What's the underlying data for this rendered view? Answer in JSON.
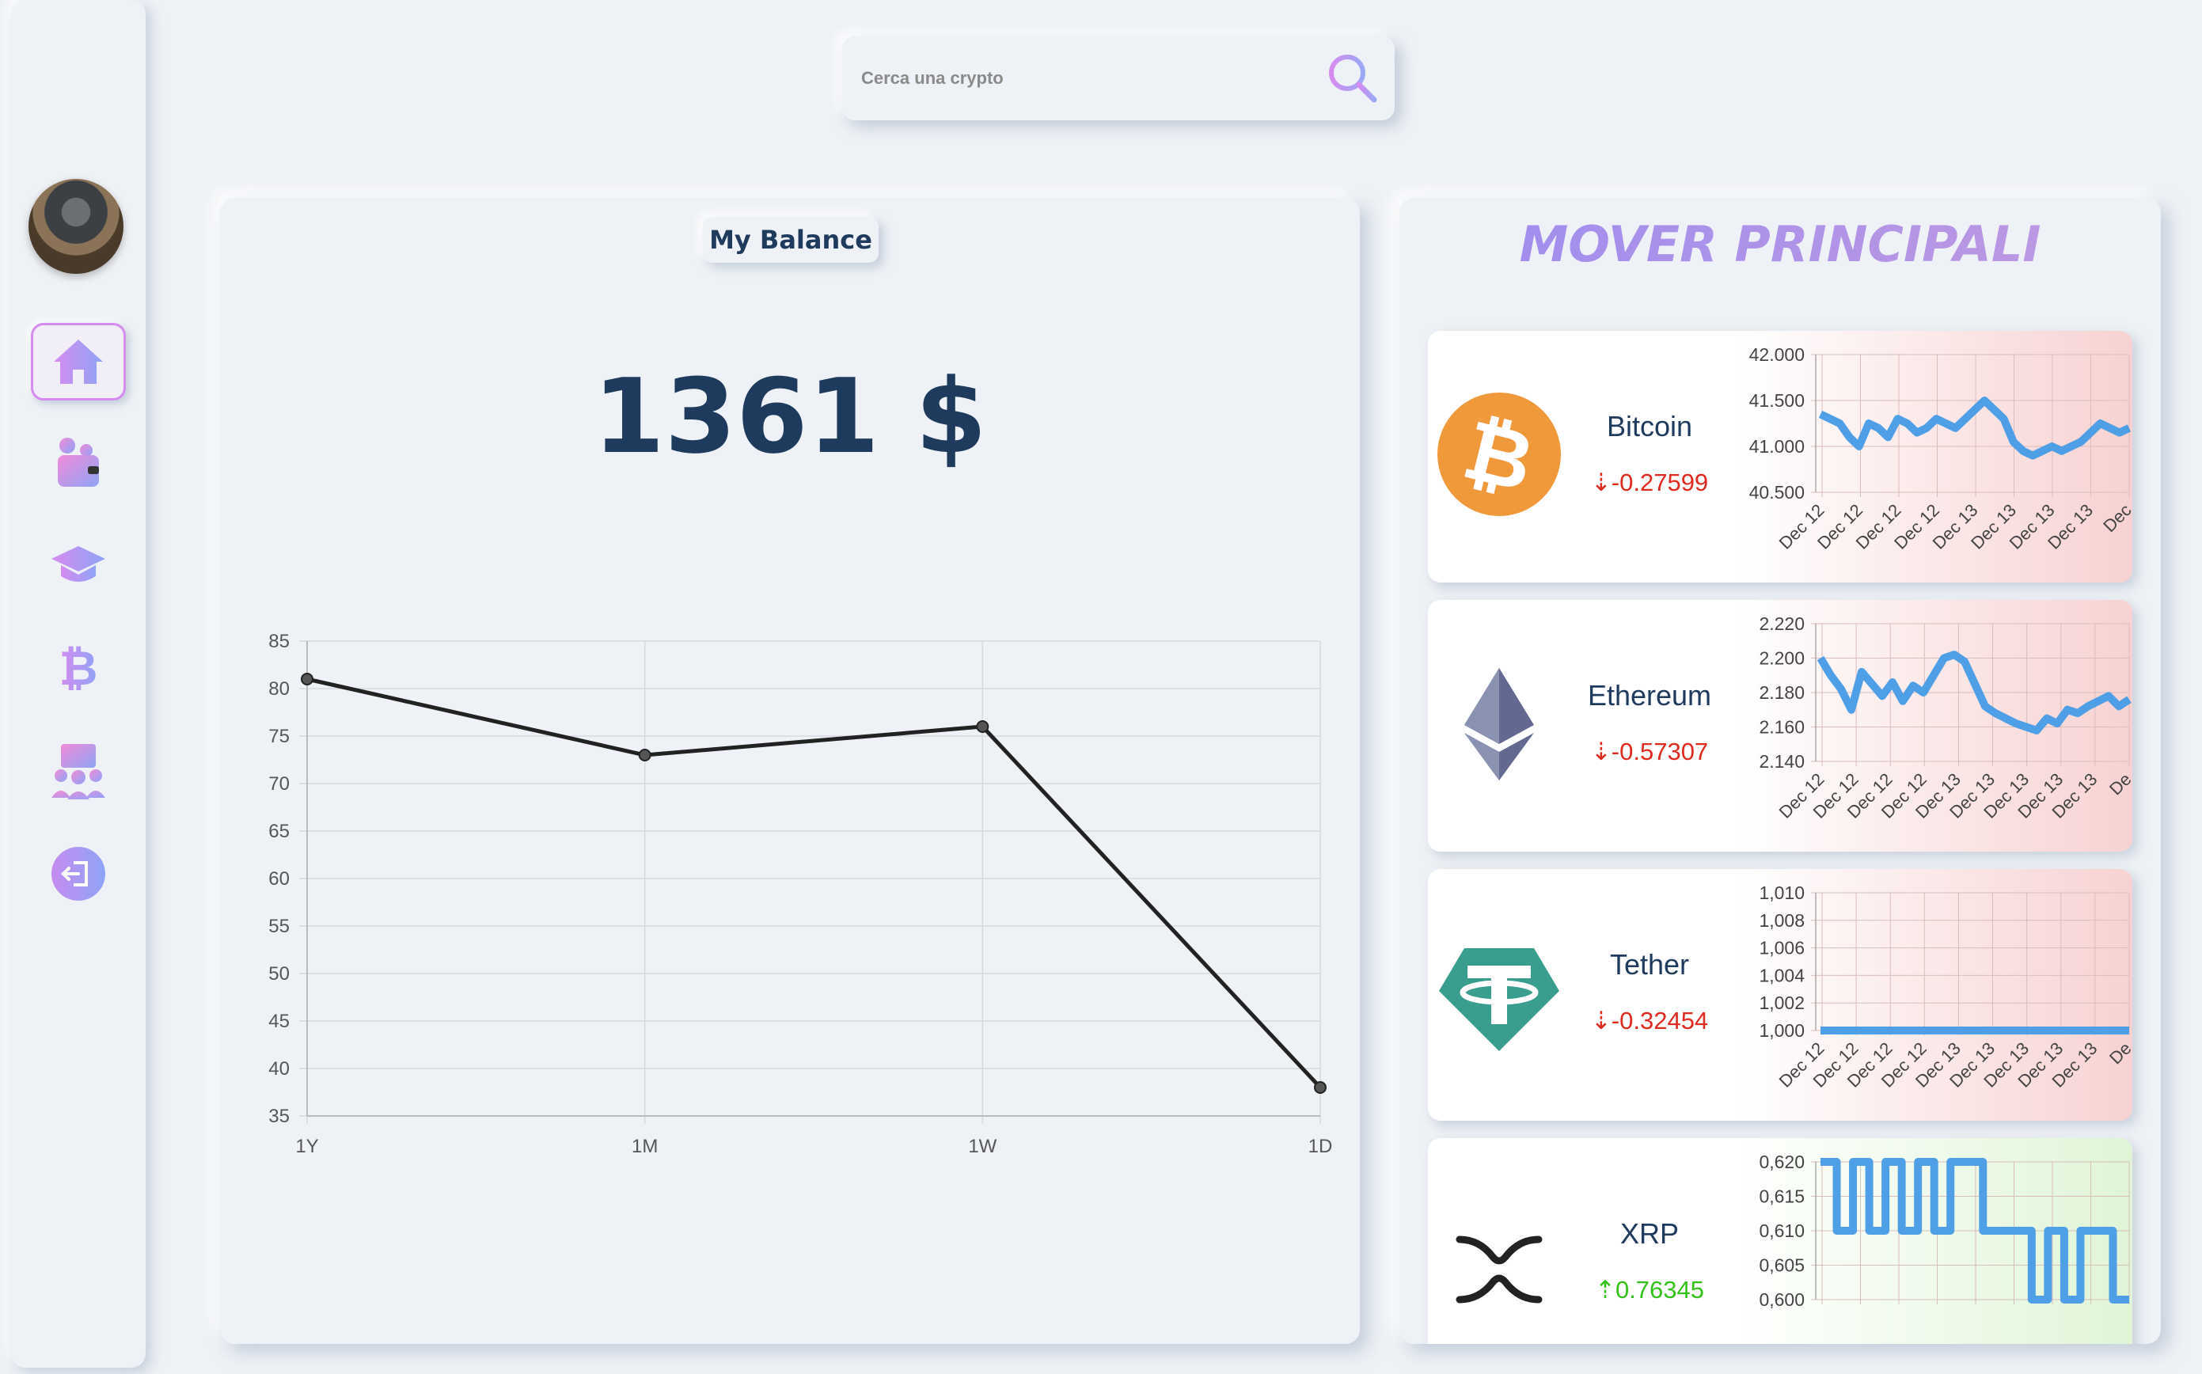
{
  "search": {
    "placeholder": "Cerca una crypto"
  },
  "sidebar": {
    "items": [
      {
        "name": "home",
        "active": true
      },
      {
        "name": "wallet"
      },
      {
        "name": "education"
      },
      {
        "name": "bitcoin"
      },
      {
        "name": "community"
      },
      {
        "name": "logout"
      }
    ]
  },
  "balance": {
    "title": "My Balance",
    "value": "1361 $",
    "chart_data": {
      "type": "line",
      "categories": [
        "1Y",
        "1M",
        "1W",
        "1D"
      ],
      "values": [
        81,
        73,
        76,
        38
      ],
      "ylim": [
        35,
        85
      ],
      "yticks": [
        35,
        40,
        45,
        50,
        55,
        60,
        65,
        70,
        75,
        80,
        85
      ],
      "grid": true,
      "line_color": "#222222"
    }
  },
  "movers": {
    "title": "MOVER PRINCIPALI",
    "coins": [
      {
        "name": "Bitcoin",
        "change": "-0.27599",
        "direction": "down",
        "icon": "bitcoin-icon",
        "chart_data": {
          "type": "line",
          "yticks": [
            "42.000",
            "41.500",
            "41.000",
            "40.500"
          ],
          "ylim": [
            40500,
            42000
          ],
          "xticks": [
            "Dec 12",
            "Dec 12",
            "Dec 12",
            "Dec 12",
            "Dec 13",
            "Dec 13",
            "Dec 13",
            "Dec 13",
            "Dec"
          ],
          "values": [
            41350,
            41300,
            41250,
            41100,
            41000,
            41250,
            41200,
            41100,
            41300,
            41250,
            41150,
            41200,
            41300,
            41250,
            41200,
            41300,
            41400,
            41500,
            41400,
            41300,
            41050,
            40950,
            40900,
            40950,
            41000,
            40950,
            41000,
            41050,
            41150,
            41250,
            41200,
            41150,
            41200
          ],
          "background": "red"
        }
      },
      {
        "name": "Ethereum",
        "change": "-0.57307",
        "direction": "down",
        "icon": "ethereum-icon",
        "chart_data": {
          "type": "line",
          "yticks": [
            "2.220",
            "2.200",
            "2.180",
            "2.160",
            "2.140"
          ],
          "ylim": [
            2140,
            2220
          ],
          "xticks": [
            "Dec 12",
            "Dec 12",
            "Dec 12",
            "Dec 12",
            "Dec 13",
            "Dec 13",
            "Dec 13",
            "Dec 13",
            "Dec 13",
            "De"
          ],
          "values": [
            2200,
            2190,
            2182,
            2170,
            2192,
            2185,
            2178,
            2186,
            2175,
            2184,
            2180,
            2190,
            2200,
            2202,
            2198,
            2185,
            2172,
            2168,
            2165,
            2162,
            2160,
            2158,
            2165,
            2162,
            2170,
            2168,
            2172,
            2175,
            2178,
            2172,
            2176
          ],
          "background": "red"
        }
      },
      {
        "name": "Tether",
        "change": "-0.32454",
        "direction": "down",
        "icon": "tether-icon",
        "chart_data": {
          "type": "line",
          "yticks": [
            "1,010",
            "1,008",
            "1,006",
            "1,004",
            "1,002",
            "1,000"
          ],
          "ylim": [
            1.0,
            1.01
          ],
          "xticks": [
            "Dec 12",
            "Dec 12",
            "Dec 12",
            "Dec 12",
            "Dec 13",
            "Dec 13",
            "Dec 13",
            "Dec 13",
            "Dec 13",
            "De"
          ],
          "values": [
            1.0,
            1.0,
            1.0,
            1.0,
            1.0,
            1.0,
            1.0,
            1.0,
            1.0,
            1.0,
            1.0,
            1.0
          ],
          "background": "red"
        }
      },
      {
        "name": "XRP",
        "change": "0.76345",
        "direction": "up",
        "icon": "xrp-icon",
        "chart_data": {
          "type": "line",
          "yticks": [
            "0,620",
            "0,615",
            "0,610",
            "0,605",
            "0,600"
          ],
          "ylim": [
            0.6,
            0.62
          ],
          "values": [
            0.62,
            0.61,
            0.62,
            0.61,
            0.62,
            0.61,
            0.62,
            0.61,
            0.62,
            0.62,
            0.61,
            0.61,
            0.61,
            0.6,
            0.61,
            0.6,
            0.61,
            0.61,
            0.6,
            0.6
          ],
          "background": "green"
        }
      }
    ]
  }
}
